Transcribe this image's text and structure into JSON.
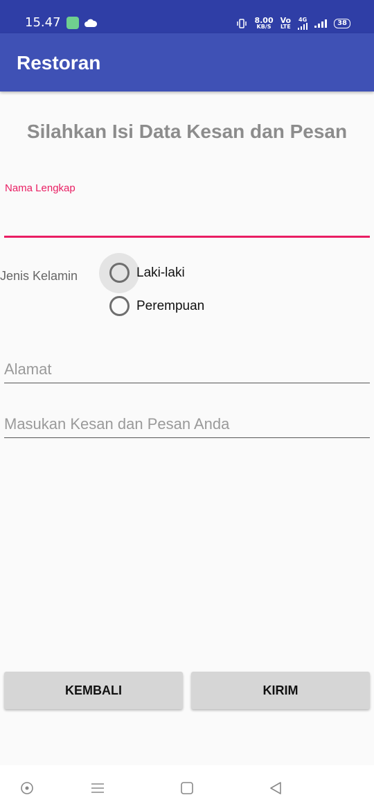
{
  "status_bar": {
    "time": "15.47",
    "speed_value": "8.00",
    "speed_unit": "KB/S",
    "volte_top": "Vo",
    "volte_bottom": "LTE",
    "network": "4G",
    "battery": "38",
    "icons": [
      "app-notification-icon",
      "cloud-icon",
      "vibrate-icon",
      "signal-icon",
      "battery-icon"
    ]
  },
  "app_bar": {
    "title": "Restoran",
    "color": "#3f51b5"
  },
  "form": {
    "heading": "Silahkan Isi Data Kesan dan Pesan",
    "name_field": {
      "label": "Nama Lengkap",
      "value": ""
    },
    "gender": {
      "label": "Jenis Kelamin",
      "options": [
        "Laki-laki",
        "Perempuan"
      ]
    },
    "address_field": {
      "placeholder": "Alamat"
    },
    "message_field": {
      "placeholder": "Masukan Kesan dan Pesan Anda"
    }
  },
  "buttons": {
    "back": "KEMBALI",
    "send": "KIRIM"
  },
  "nav_bar": {
    "icons": [
      "screen-record-icon",
      "menu-icon",
      "home-icon",
      "back-icon"
    ]
  },
  "colors": {
    "accent": "#e91e63",
    "primary": "#3f51b5",
    "primary_dark": "#2f3ea6"
  }
}
